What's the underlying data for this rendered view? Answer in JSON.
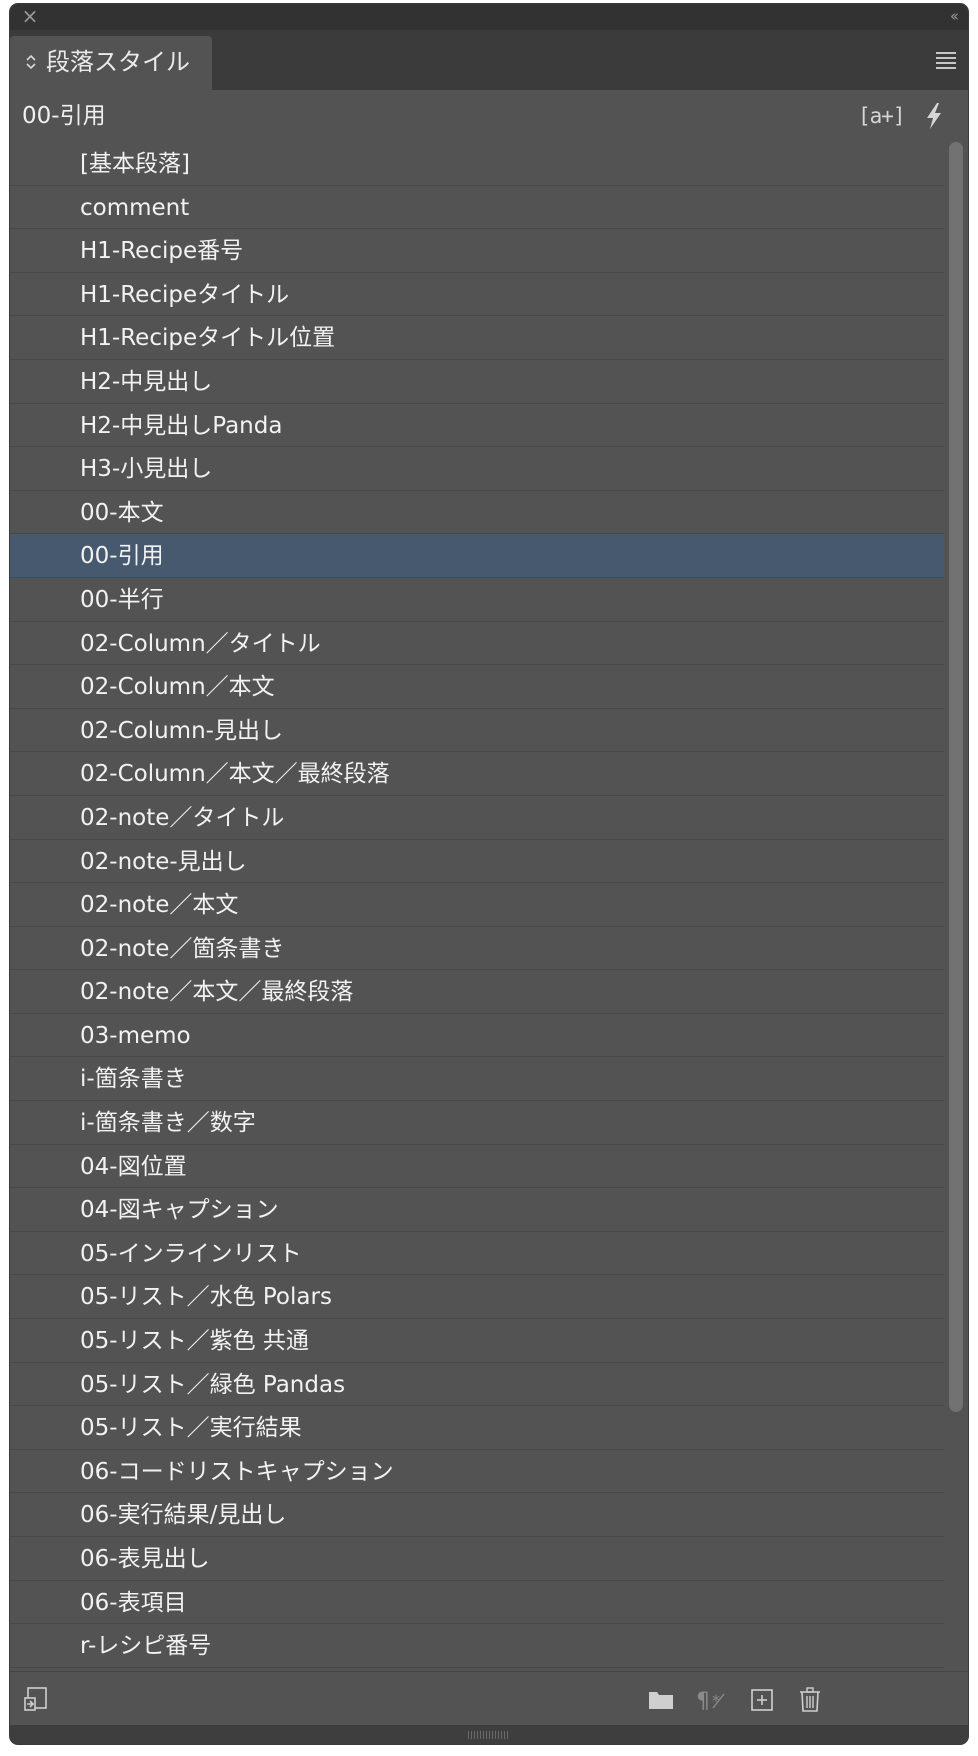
{
  "panel": {
    "title": "段落スタイル",
    "current_style": "00-引用",
    "new_override_icon_text": "[a+]",
    "close_glyph": "×",
    "collapse_glyph": "‹‹",
    "tab_updown_glyph": "◇"
  },
  "styles": [
    {
      "label": "[基本段落]"
    },
    {
      "label": "comment"
    },
    {
      "label": "H1-Recipe番号"
    },
    {
      "label": "H1-Recipeタイトル"
    },
    {
      "label": "H1-Recipeタイトル位置"
    },
    {
      "label": "H2-中見出し"
    },
    {
      "label": "H2-中見出しPanda"
    },
    {
      "label": "H3-小見出し"
    },
    {
      "label": "00-本文"
    },
    {
      "label": "00-引用",
      "selected": true
    },
    {
      "label": "00-半行"
    },
    {
      "label": "02-Column／タイトル"
    },
    {
      "label": "02-Column／本文"
    },
    {
      "label": "02-Column-見出し"
    },
    {
      "label": "02-Column／本文／最終段落"
    },
    {
      "label": "02-note／タイトル"
    },
    {
      "label": "02-note-見出し"
    },
    {
      "label": "02-note／本文"
    },
    {
      "label": "02-note／箇条書き"
    },
    {
      "label": "02-note／本文／最終段落"
    },
    {
      "label": "03-memo"
    },
    {
      "label": "i-箇条書き"
    },
    {
      "label": "i-箇条書き／数字"
    },
    {
      "label": "04-図位置"
    },
    {
      "label": "04-図キャプション"
    },
    {
      "label": "05-インラインリスト"
    },
    {
      "label": "05-リスト／水色 Polars"
    },
    {
      "label": "05-リスト／紫色 共通"
    },
    {
      "label": "05-リスト／緑色 Pandas"
    },
    {
      "label": "05-リスト／実行結果"
    },
    {
      "label": "06-コードリストキャプション"
    },
    {
      "label": "06-実行結果/見出し"
    },
    {
      "label": "06-表見出し"
    },
    {
      "label": "06-表項目"
    },
    {
      "label": "r-レシピ番号"
    }
  ],
  "colors": {
    "panel_bg": "#535353",
    "selected_row": "#46596f",
    "text": "#f2f2f2"
  },
  "icons": {
    "header": [
      "new-style-override-icon",
      "quick-apply-icon"
    ],
    "footer": [
      "load-styles-icon",
      "new-group-icon",
      "clear-overrides-icon",
      "new-style-icon",
      "delete-icon"
    ]
  }
}
